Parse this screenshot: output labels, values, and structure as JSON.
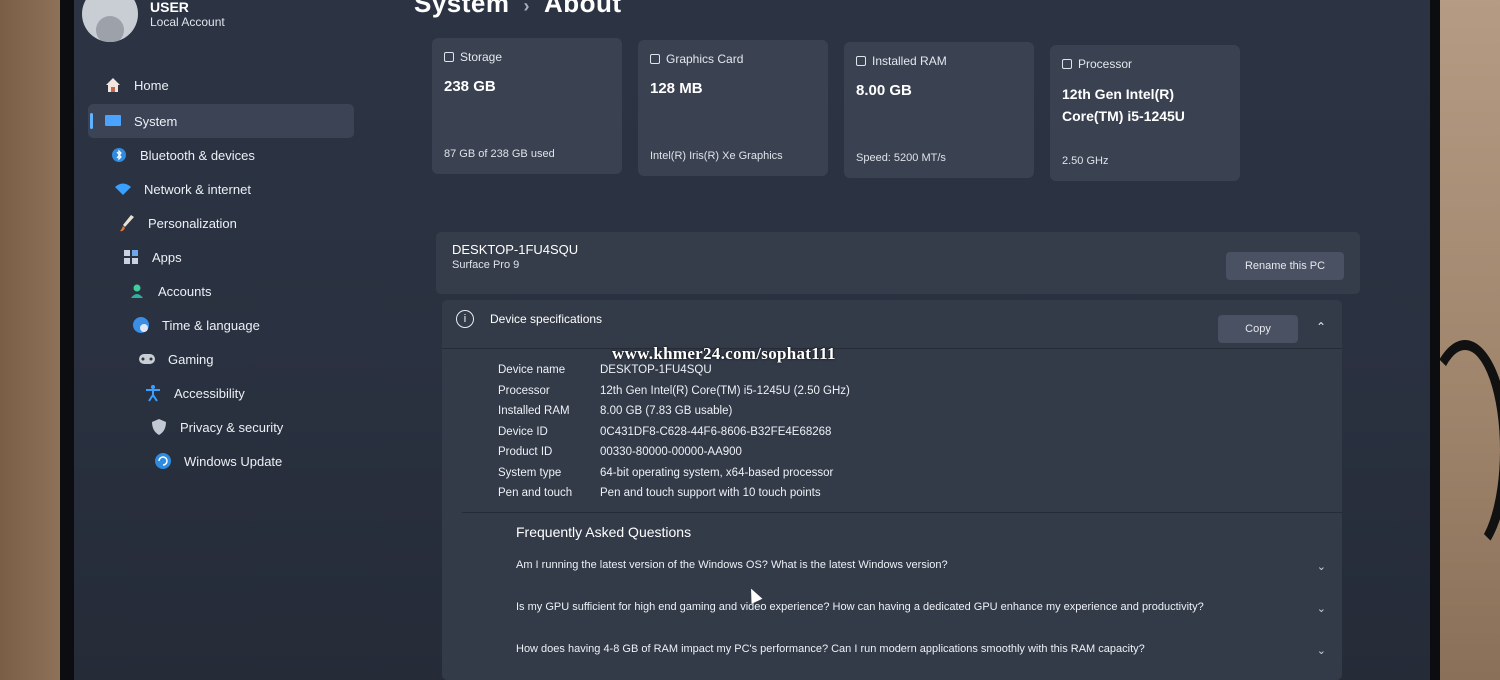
{
  "user": {
    "name": "USER",
    "account_type": "Local Account"
  },
  "breadcrumb": {
    "parent": "System",
    "separator": "›",
    "current": "About"
  },
  "nav": {
    "items": [
      {
        "label": "Home",
        "icon": "home-icon"
      },
      {
        "label": "System",
        "icon": "system-icon",
        "active": true
      },
      {
        "label": "Bluetooth & devices",
        "icon": "bluetooth-icon"
      },
      {
        "label": "Network & internet",
        "icon": "wifi-icon"
      },
      {
        "label": "Personalization",
        "icon": "brush-icon"
      },
      {
        "label": "Apps",
        "icon": "apps-icon"
      },
      {
        "label": "Accounts",
        "icon": "person-icon"
      },
      {
        "label": "Time & language",
        "icon": "globe-clock-icon"
      },
      {
        "label": "Gaming",
        "icon": "gamepad-icon"
      },
      {
        "label": "Accessibility",
        "icon": "accessibility-icon"
      },
      {
        "label": "Privacy & security",
        "icon": "shield-icon"
      },
      {
        "label": "Windows Update",
        "icon": "update-icon"
      }
    ]
  },
  "cards": [
    {
      "title": "Storage",
      "value": "238 GB",
      "sub": "87 GB of 238 GB used",
      "icon": "storage-icon"
    },
    {
      "title": "Graphics Card",
      "value": "128 MB",
      "sub": "Intel(R) Iris(R) Xe Graphics",
      "icon": "gpu-icon"
    },
    {
      "title": "Installed RAM",
      "value": "8.00 GB",
      "sub": "Speed: 5200 MT/s",
      "icon": "ram-icon"
    },
    {
      "title": "Processor",
      "value": "12th Gen Intel(R) Core(TM) i5-1245U",
      "sub": "2.50 GHz",
      "icon": "processor-icon"
    }
  ],
  "device": {
    "name": "DESKTOP-1FU4SQU",
    "model": "Surface Pro 9",
    "rename_label": "Rename this PC"
  },
  "specs": {
    "title": "Device specifications",
    "copy_label": "Copy",
    "rows": [
      {
        "label": "Device name",
        "value": "DESKTOP-1FU4SQU"
      },
      {
        "label": "Processor",
        "value": "12th Gen Intel(R) Core(TM) i5-1245U (2.50 GHz)"
      },
      {
        "label": "Installed RAM",
        "value": "8.00 GB (7.83 GB usable)"
      },
      {
        "label": "Device ID",
        "value": "0C431DF8-C628-44F6-8606-B32FE4E68268"
      },
      {
        "label": "Product ID",
        "value": "00330-80000-00000-AA900"
      },
      {
        "label": "System type",
        "value": "64-bit operating system, x64-based processor"
      },
      {
        "label": "Pen and touch",
        "value": "Pen and touch support with 10 touch points"
      }
    ]
  },
  "watermark": "www.khmer24.com/sophat111",
  "faq": {
    "title": "Frequently Asked Questions",
    "items": [
      "Am I running the latest version of the Windows OS? What is the latest Windows version?",
      "Is my GPU sufficient for high end gaming and video experience? How can having a dedicated GPU enhance my experience and productivity?",
      "How does having 4-8 GB of RAM impact my PC's performance? Can I run modern applications smoothly with this RAM capacity?"
    ]
  }
}
